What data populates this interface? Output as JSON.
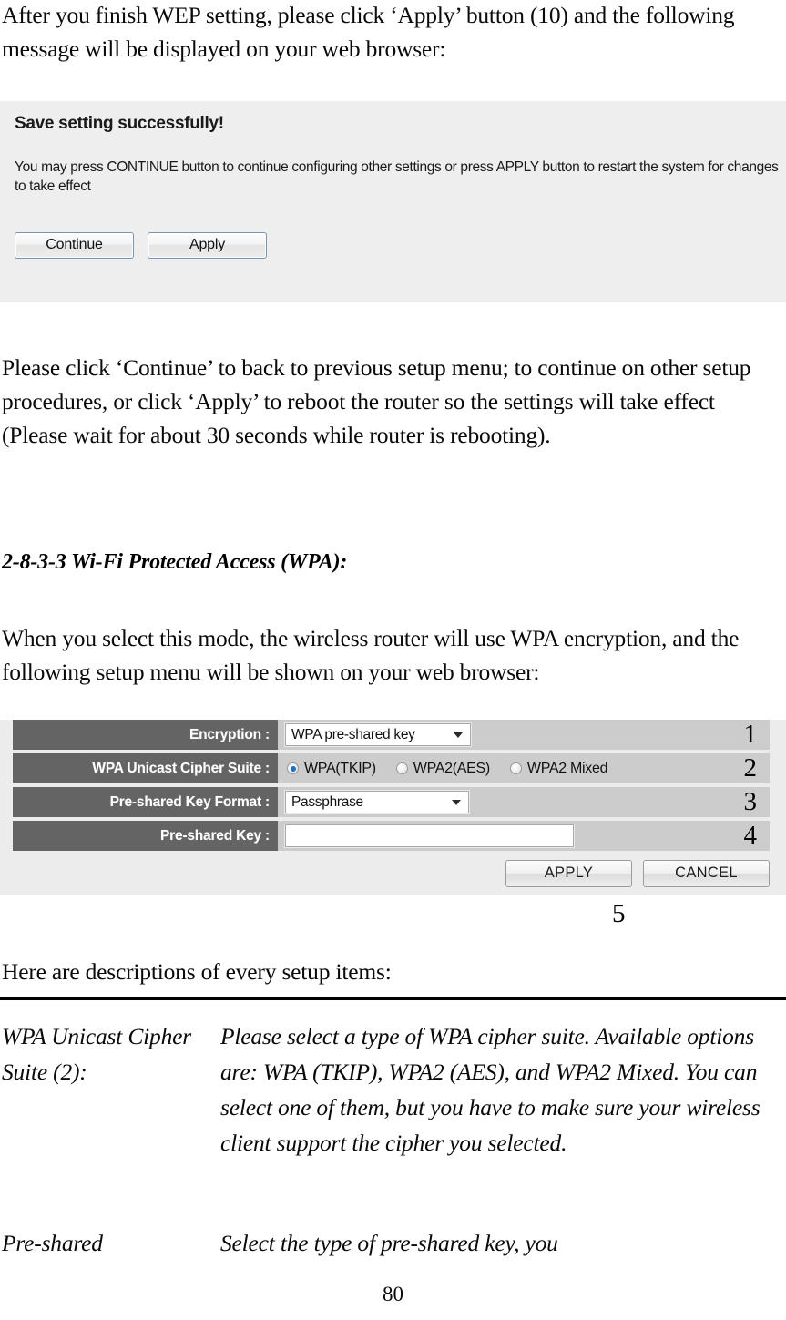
{
  "intro": {
    "paragraph": "After you finish WEP setting, please click ‘Apply’ button (10) and the following message will be displayed on your web browser:"
  },
  "save_dialog": {
    "title": "Save setting successfully!",
    "body": "You may press CONTINUE button to continue configuring other settings or press APPLY button to restart the system for changes to take effect",
    "continue_label": "Continue",
    "apply_label": "Apply"
  },
  "continue_paragraph": "Please click ‘Continue’ to back to previous setup menu; to continue on other setup procedures, or click ‘Apply’ to reboot the router so the settings will take effect (Please wait for about 30 seconds while router is rebooting).",
  "section": {
    "heading": "2-8-3-3 Wi-Fi Protected Access (WPA):",
    "intro": "When you select this mode, the wireless router will use WPA encryption, and the following setup menu will be shown on your web browser:"
  },
  "wpa_panel": {
    "rows": [
      {
        "label": "Encryption :",
        "control": "select",
        "value": "WPA pre-shared key",
        "callout": "1"
      },
      {
        "label": "WPA Unicast Cipher Suite :",
        "control": "radios",
        "options": [
          {
            "label": "WPA(TKIP)",
            "checked": true
          },
          {
            "label": "WPA2(AES)",
            "checked": false
          },
          {
            "label": "WPA2 Mixed",
            "checked": false
          }
        ],
        "callout": "2"
      },
      {
        "label": "Pre-shared Key Format :",
        "control": "select",
        "value": "Passphrase",
        "callout": "3"
      },
      {
        "label": "Pre-shared Key :",
        "control": "text",
        "value": "",
        "callout": "4"
      }
    ],
    "apply_label": "APPLY",
    "cancel_label": "CANCEL",
    "actions_callout": "5",
    "colors": {
      "label_bg": "#646464",
      "label_text": "#ffffff",
      "value_bg": "#cccccc",
      "panel_bg": "#ececec",
      "radio_accent": "#1b6fc4"
    }
  },
  "descriptions": {
    "lead": "Here are descriptions of every setup items:",
    "items": [
      {
        "term": "WPA Unicast Cipher Suite (2):",
        "text": "Please select a type of WPA cipher suite. Available options are: WPA (TKIP), WPA2 (AES), and WPA2 Mixed. You can select one of them, but you have to make sure your wireless client support the cipher you selected."
      },
      {
        "term": "Pre-shared",
        "text": "Select the type of pre-shared key, you"
      }
    ]
  },
  "page_number": "80"
}
